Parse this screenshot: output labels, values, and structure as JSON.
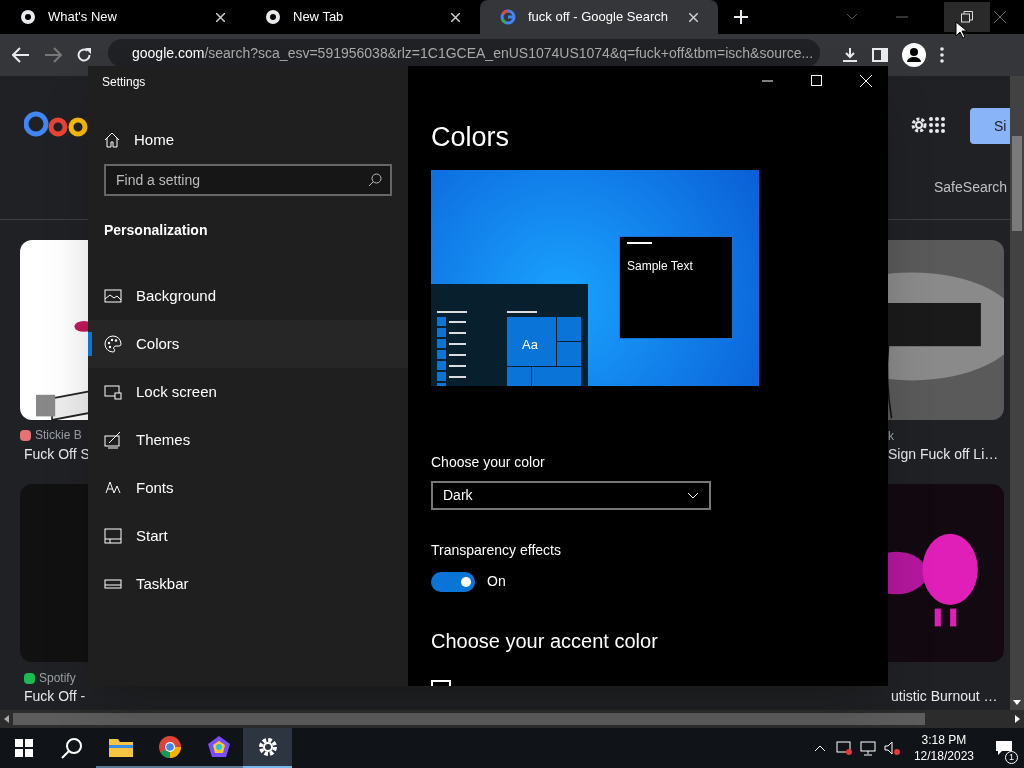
{
  "browser": {
    "tabs": [
      {
        "title": "What's New",
        "selected": false
      },
      {
        "title": "New Tab",
        "selected": false
      },
      {
        "title": "fuck off - Google Search",
        "selected": true
      }
    ],
    "address": {
      "host": "google.com",
      "path": "/search?sca_esv=591956038&rlz=1C1GCEA_enUS1074US1074&q=fuck+off&tbm=isch&source..."
    },
    "forward_disabled": true
  },
  "page": {
    "sign_in": "Si",
    "safesearch": "SafeSearch",
    "left_results": [
      {
        "source": "Stickie B",
        "title": "Fuck Off S"
      },
      {
        "source": "Spotify",
        "title": "Fuck Off -"
      }
    ],
    "right_results": [
      {
        "source": "k",
        "title": "Sign Fuck off Li…"
      },
      {
        "title": "utistic Burnout …"
      }
    ]
  },
  "settings": {
    "title": "Settings",
    "home": "Home",
    "search": {
      "placeholder": "Find a setting"
    },
    "section": "Personalization",
    "nav": [
      {
        "label": "Background",
        "selected": false
      },
      {
        "label": "Colors",
        "selected": true
      },
      {
        "label": "Lock screen",
        "selected": false
      },
      {
        "label": "Themes",
        "selected": false
      },
      {
        "label": "Fonts",
        "selected": false
      },
      {
        "label": "Start",
        "selected": false
      },
      {
        "label": "Taskbar",
        "selected": false
      }
    ],
    "heading": "Colors",
    "preview": {
      "sample_text": "Sample Text",
      "tile": "Aa"
    },
    "choose_color": {
      "label": "Choose your color",
      "value": "Dark"
    },
    "transparency": {
      "label": "Transparency effects",
      "on": true,
      "state": "On"
    },
    "accent_heading": "Choose your accent color",
    "accent_auto": {
      "checked": false
    }
  },
  "taskbar": {
    "apps": [
      {
        "active": false
      },
      {
        "active": false
      },
      {
        "active": false
      },
      {
        "active": true
      }
    ],
    "time": "3:18 PM",
    "date": "12/18/2023",
    "notifications": "1"
  }
}
